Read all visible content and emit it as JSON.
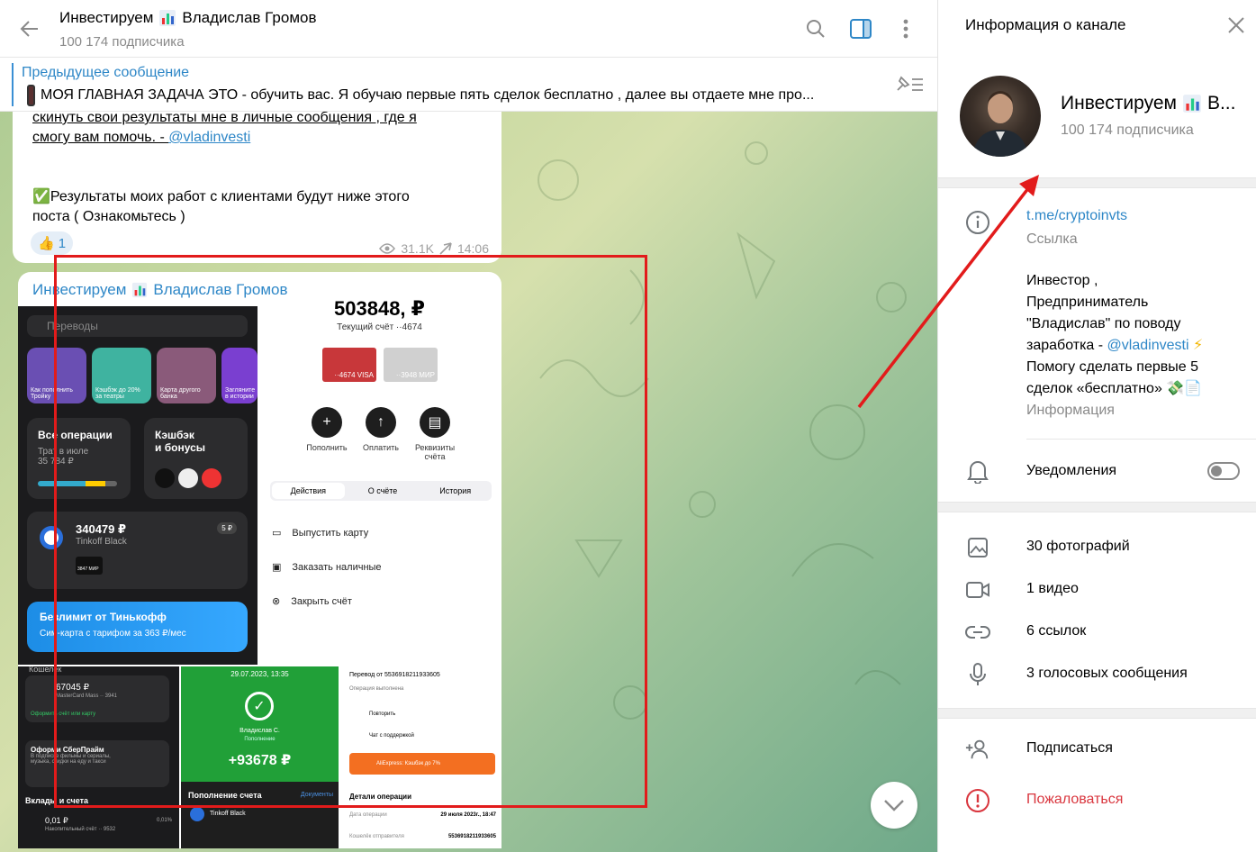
{
  "header": {
    "title": "Инвестируем",
    "title_suffix": "Владислав Громов",
    "subscribers": "100 174 подписчика"
  },
  "pinned": {
    "label": "Предыдущее сообщение",
    "text": "МОЯ ГЛАВНАЯ ЗАДАЧА ЭТО - обучить вас. Я обучаю первые пять сделок бесплатно , далее вы отдаете мне про..."
  },
  "message1": {
    "line1": "скинуть свои результаты мне в личные сообщения , где я",
    "line2_text": "смогу вам помочь. - ",
    "line2_link": "@vladinvesti",
    "line3": "✅Результаты моих работ с клиентами будут ниже этого",
    "line4": "поста ( Ознакомьтесь )",
    "reaction_emoji": "👍",
    "reaction_count": "1",
    "views": "31.1K",
    "time": "14:06"
  },
  "message2": {
    "author": "Инвестируем",
    "author_suffix": "Владислав Громов",
    "shot1": {
      "search_placeholder": "Переводы",
      "stories": [
        "Как пополнить Тройку",
        "Кэшбэк до 20% за театры",
        "Карта другого банка",
        "Загляните в истории"
      ],
      "ops_title": "Все операции",
      "ops_sub1": "Трат в июле",
      "ops_sub2": "35 784 ₽",
      "cashback_title": "Кэшбэк",
      "cashback_title2": "и бонусы",
      "balance": "340479 ₽",
      "card_name": "Tinkoff Black",
      "card_badge": "5 ₽",
      "card_mini": "3847 МИР",
      "promo_title": "Безлимит от Тинькофф",
      "promo_sub": "Сим-карта с тарифом за 363 ₽/мес"
    },
    "shot2": {
      "balance": "503848, ₽",
      "account": "Текущий счёт ··4674",
      "card1": "··4674 VISA",
      "card2": "··3948 МИР",
      "actions": [
        "Пополнить",
        "Оплатить",
        "Реквизиты счёта"
      ],
      "tabs": [
        "Действия",
        "О счёте",
        "История"
      ],
      "rows": [
        "Выпустить карту",
        "Заказать наличные",
        "Закрыть счёт"
      ]
    },
    "shot3": {
      "wallet": "Кошелёк",
      "amount": "67045 ₽",
      "card": "MasterCard Mass ·· 3941",
      "link": "Оформить счёт или карту",
      "promo_title": "Оформи СберПрайм",
      "promo_text": "В подписке фильмы и сериалы, музыка, скидки на еду и такси",
      "deposits": "Вклады и счета",
      "dep_amount": "0,01 ₽",
      "dep_sub": "Накопительный счёт ·· 9532",
      "dep_rate": "0,01%"
    },
    "shot4": {
      "date": "29.07.2023, 13:35",
      "name": "Владислав С.",
      "status": "Пополнение",
      "amount": "+93678 ₽",
      "section": "Пополнение счета",
      "docs": "Документы",
      "card": "Tinkoff Black"
    },
    "shot5": {
      "transfer": "Перевод от 5536918211933605",
      "done": "Операция выполнена",
      "repeat": "Повторить",
      "support": "Чат с поддержкой",
      "ali": "AliExpress: Кэшбэк до 7%",
      "details": "Детали операции",
      "date_label": "Дата операции",
      "date_value": "29 июля 2023г., 18:47",
      "wallet_label": "Кошелёк отправителя",
      "wallet_value": "5536918211933605"
    }
  },
  "info_panel": {
    "heading": "Информация о канале",
    "channel_name": "Инвестируем",
    "channel_name_tail": "В...",
    "subscribers": "100 174 подписчика",
    "link": "t.me/cryptoinvts",
    "link_label": "Ссылка",
    "description_lines": [
      "Инвестор ,",
      "Предприниматель",
      "\"Владислав\" по поводу",
      "заработка - ",
      "Помогу сделать первые 5",
      "сделок «бесплатно» 💸📄"
    ],
    "description_link": "@vladinvesti",
    "description_emoji": "⚡",
    "description_label": "Информация",
    "notifications": "Уведомления",
    "notifications_on": false,
    "media": [
      "30 фотографий",
      "1 видео",
      "6 ссылок",
      "3 голосовых сообщения"
    ],
    "subscribe": "Подписаться",
    "report": "Пожаловаться"
  },
  "colors": {
    "accent": "#2e87c7",
    "annotation": "#e21b1b",
    "danger": "#d9363e"
  }
}
